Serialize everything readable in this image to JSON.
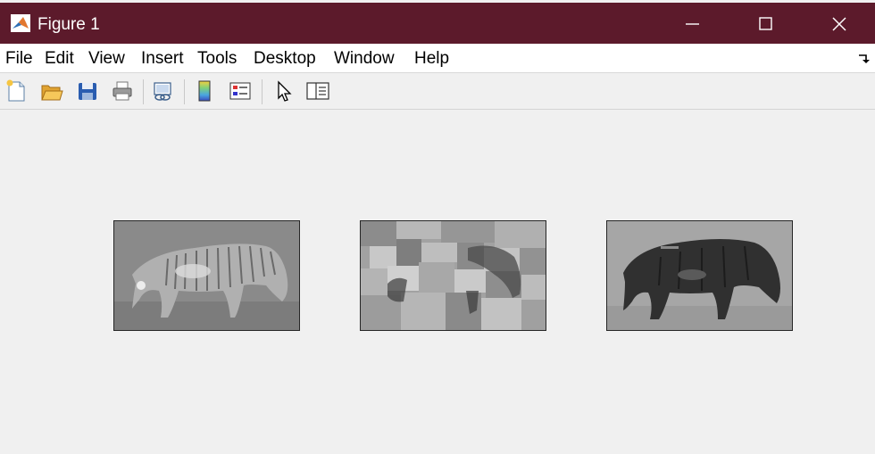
{
  "window": {
    "title": "Figure 1",
    "icons": {
      "app": "matlab-logo-icon",
      "minimize": "minimize-icon",
      "maximize": "maximize-icon",
      "close": "close-icon"
    },
    "colors": {
      "titlebar": "#5c1a2b"
    }
  },
  "menu": {
    "items": [
      "File",
      "Edit",
      "View",
      "Insert",
      "Tools",
      "Desktop",
      "Window",
      "Help"
    ],
    "dock_icon": "dock-arrow-icon"
  },
  "toolbar": {
    "buttons": [
      "new-figure-icon",
      "open-file-icon",
      "save-icon",
      "print-icon",
      "link-plot-icon",
      "insert-colorbar-icon",
      "insert-legend-icon",
      "edit-plot-icon",
      "property-inspector-icon"
    ]
  },
  "figure": {
    "panels": [
      {
        "name": "zebra-grayscale",
        "content": "grayscale zebra image"
      },
      {
        "name": "zebra-segmented",
        "content": "block segmented zebra image"
      },
      {
        "name": "zebra-foreground",
        "content": "dark zebra silhouette image"
      }
    ]
  }
}
